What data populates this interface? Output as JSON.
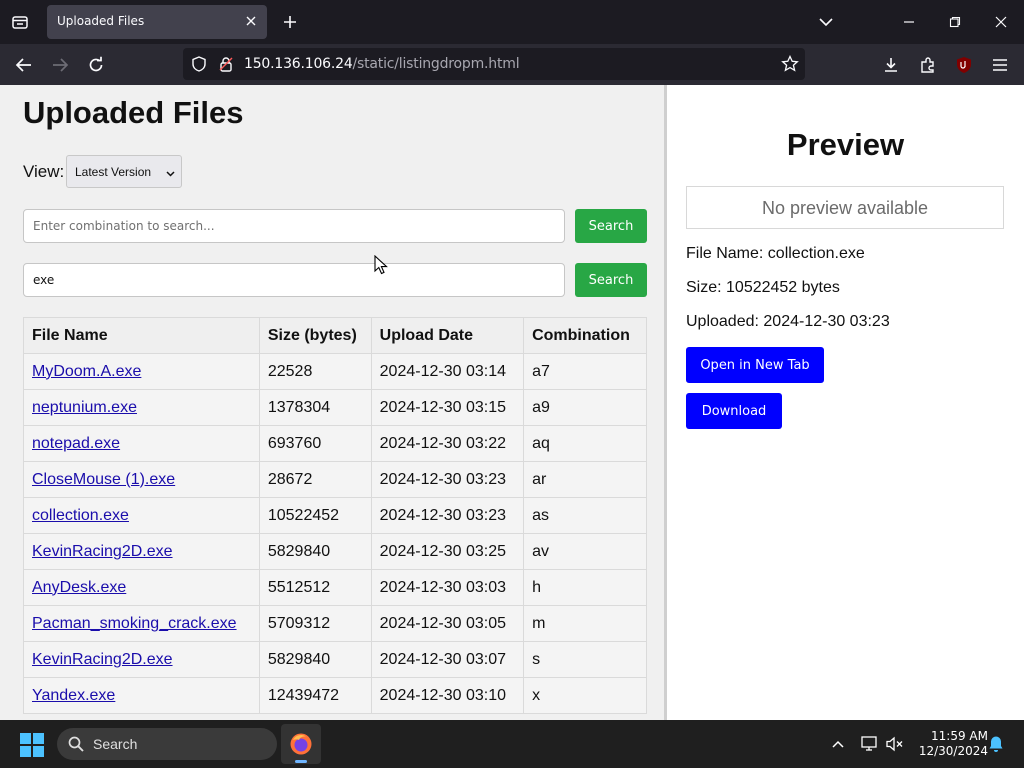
{
  "browser": {
    "tab_title": "Uploaded Files",
    "url_host": "150.136.106.24",
    "url_path": "/static/listingdropm.html"
  },
  "page": {
    "title": "Uploaded Files",
    "view_label": "View:",
    "view_selected": "Latest Version",
    "search1": {
      "placeholder": "Enter combination to search...",
      "value": "",
      "button": "Search"
    },
    "search2": {
      "placeholder": "",
      "value": "exe",
      "button": "Search"
    },
    "table": {
      "headers": [
        "File Name",
        "Size (bytes)",
        "Upload Date",
        "Combination"
      ],
      "rows": [
        [
          "MyDoom.A.exe",
          "22528",
          "2024-12-30 03:14",
          "a7"
        ],
        [
          "neptunium.exe",
          "1378304",
          "2024-12-30 03:15",
          "a9"
        ],
        [
          "notepad.exe",
          "693760",
          "2024-12-30 03:22",
          "aq"
        ],
        [
          "CloseMouse (1).exe",
          "28672",
          "2024-12-30 03:23",
          "ar"
        ],
        [
          "collection.exe",
          "10522452",
          "2024-12-30 03:23",
          "as"
        ],
        [
          "KevinRacing2D.exe",
          "5829840",
          "2024-12-30 03:25",
          "av"
        ],
        [
          "AnyDesk.exe",
          "5512512",
          "2024-12-30 03:03",
          "h"
        ],
        [
          "Pacman_smoking_crack.exe",
          "5709312",
          "2024-12-30 03:05",
          "m"
        ],
        [
          "KevinRacing2D.exe",
          "5829840",
          "2024-12-30 03:07",
          "s"
        ],
        [
          "Yandex.exe",
          "12439472",
          "2024-12-30 03:10",
          "x"
        ]
      ]
    }
  },
  "preview": {
    "title": "Preview",
    "no_preview": "No preview available",
    "file_name": "File Name: collection.exe",
    "size": "Size: 10522452 bytes",
    "uploaded": "Uploaded: 2024-12-30 03:23",
    "open_btn": "Open in New Tab",
    "download_btn": "Download"
  },
  "taskbar": {
    "search_label": "Search",
    "time": "11:59 AM",
    "date": "12/30/2024"
  },
  "colors": {
    "accent_green": "#28a745",
    "accent_blue": "#0000ff",
    "link": "#1a0dab"
  }
}
